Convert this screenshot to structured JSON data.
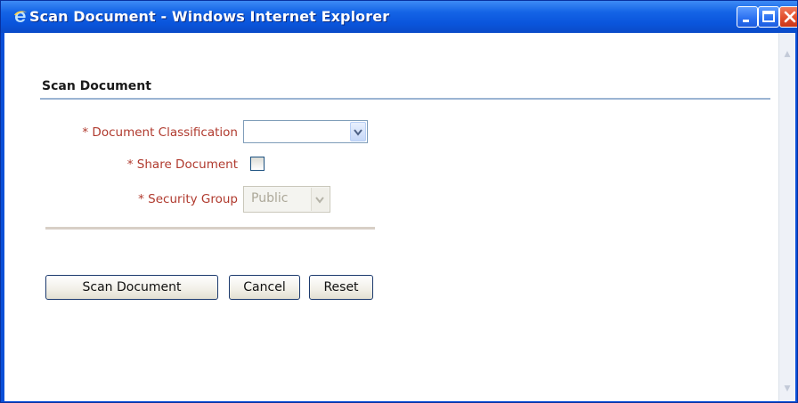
{
  "window": {
    "title": "Scan Document - Windows Internet Explorer",
    "controls": {
      "minimize_icon": "minimize-icon",
      "maximize_icon": "maximize-icon",
      "close_icon": "close-icon"
    },
    "app_icon": "internet-explorer-icon"
  },
  "form": {
    "section_title": "Scan Document",
    "fields": {
      "document_classification": {
        "label": "* Document Classification",
        "value": ""
      },
      "share_document": {
        "label": "* Share Document",
        "checked": false
      },
      "security_group": {
        "label": "* Security Group",
        "value": "Public",
        "disabled": true
      }
    }
  },
  "actions": {
    "scan_label": "Scan Document",
    "cancel_label": "Cancel",
    "reset_label": "Reset"
  },
  "colors": {
    "titlebar": "#0a55dc",
    "label_text": "#b03a2e",
    "section_rule": "#9bb4d3"
  }
}
